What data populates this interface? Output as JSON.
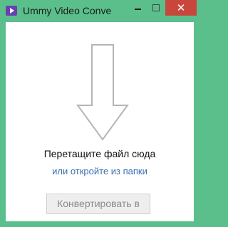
{
  "window": {
    "title": "Ummy Video Conve",
    "close_glyph": "✕",
    "icon": "ummy-video-converter-icon"
  },
  "main": {
    "drop_text": "Перетащите файл сюда",
    "open_link": "или откройте из папки",
    "convert_label": "Конвертировать в"
  },
  "colors": {
    "frame": "#5bbf8c",
    "close_button": "#c9463d",
    "link": "#3a6fb0",
    "arrow_stroke": "#b5b5b5"
  }
}
